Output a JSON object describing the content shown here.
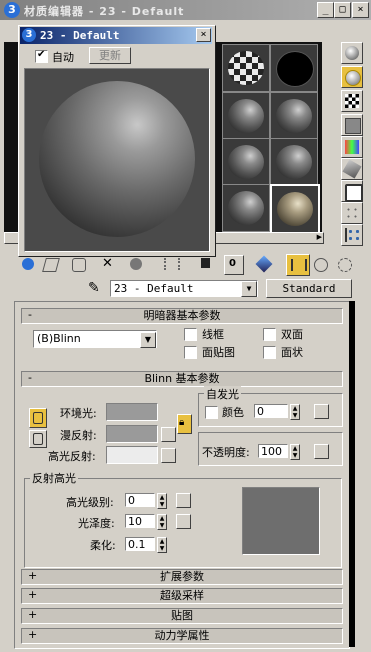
{
  "main_window": {
    "title": "材质编辑器 - 23 - Default",
    "buttons": {
      "min": "_",
      "max": "□",
      "close": "×"
    }
  },
  "preview_window": {
    "title": "23 - Default",
    "auto_label": "自动",
    "auto_checked": true,
    "update_label": "更新",
    "close": "×"
  },
  "material_bar": {
    "name": "23 - Default",
    "type_button": "Standard"
  },
  "shader_basic": {
    "header": "明暗器基本参数",
    "sign": "-",
    "shader_value": "(B)Blinn",
    "options": [
      {
        "label": "线框"
      },
      {
        "label": "双面"
      },
      {
        "label": "面贴图"
      },
      {
        "label": "面状"
      }
    ]
  },
  "blinn_basic": {
    "header": "Blinn 基本参数",
    "sign": "-",
    "ambient_label": "环境光:",
    "diffuse_label": "漫反射:",
    "specular_label": "高光反射:",
    "self_illum": {
      "group_title": "自发光",
      "color_label": "颜色",
      "value": "0"
    },
    "opacity": {
      "label": "不透明度:",
      "value": "100"
    },
    "specular_highlights": {
      "group_title": "反射高光",
      "level_label": "高光级别:",
      "level_value": "0",
      "gloss_label": "光泽度:",
      "gloss_value": "10",
      "soften_label": "柔化:",
      "soften_value": "0.1"
    }
  },
  "rollouts": [
    {
      "sign": "+",
      "label": "扩展参数"
    },
    {
      "sign": "+",
      "label": "超级采样"
    },
    {
      "sign": "+",
      "label": "贴图"
    },
    {
      "sign": "+",
      "label": "动力学属性"
    }
  ],
  "colors": {
    "title_gradient_start": "#808080",
    "panel_bg": "#d4d0c8",
    "preview_bg": "#4a4a4a",
    "ambient_swatch": "#9a9a9a",
    "diffuse_swatch": "#9a9a9a",
    "specular_swatch": "#ececec",
    "highlight_graph": "#6e6e6e"
  }
}
